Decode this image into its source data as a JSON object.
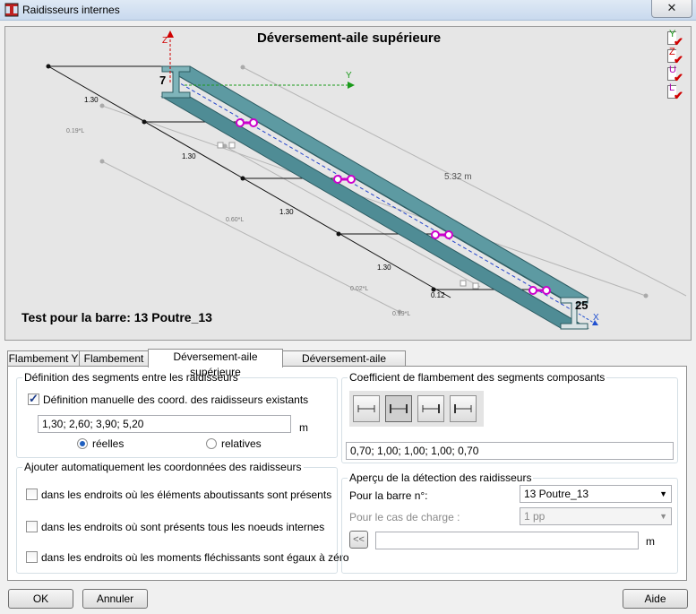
{
  "window": {
    "title": "Raidisseurs internes",
    "close_label": "✕"
  },
  "view": {
    "title": "Déversement-aile supérieure",
    "caption": "Test pour la barre: 13 Poutre_13",
    "axis_z": "Z",
    "axis_y": "Y",
    "axis_x": "X",
    "node_start": "7",
    "node_end": "25",
    "length_label": "5.32  m",
    "segment_label": "1.30",
    "offset_labels": [
      "0.19*L",
      "0.60*L",
      "0.02*L",
      "0.12",
      "0.19*L"
    ],
    "toggles": [
      {
        "label": "Y",
        "color": "#1a9a1a"
      },
      {
        "label": "Z",
        "color": "#d00000"
      },
      {
        "label": "U",
        "color": "#b000b0"
      },
      {
        "label": "L",
        "color": "#b000b0"
      }
    ],
    "colors": {
      "beam": "#5d9aa2",
      "marker": "#cc00cc",
      "axis_z": "#d00000",
      "axis_y": "#1a9a1a",
      "axis_x": "#2050d0"
    }
  },
  "tabs": [
    {
      "label": "Flambement Y",
      "active": false
    },
    {
      "label": "Flambement Z",
      "active": false
    },
    {
      "label": "Déversement-aile supérieure",
      "active": true
    },
    {
      "label": "Déversement-aile inférieure",
      "active": false
    }
  ],
  "segments": {
    "group_label": "Définition des segments entre les raidisseurs",
    "manual_label": "Définition manuelle des coord. des raidisseurs existants",
    "manual_checked": true,
    "coords_value": "1,30; 2,60; 3,90; 5,20",
    "unit": "m",
    "radio_real": "réelles",
    "radio_relative": "relatives",
    "selected": "réelles"
  },
  "auto": {
    "group_label": "Ajouter automatiquement les coordonnées des raidisseurs",
    "options": [
      {
        "label": "dans les endroits où les éléments aboutissants sont présents",
        "checked": false
      },
      {
        "label": "dans les endroits où sont présents tous les noeuds internes",
        "checked": false
      },
      {
        "label": "dans les endroits où les moments fléchissants sont égaux à zéro",
        "checked": false
      }
    ]
  },
  "coef": {
    "group_label": "Coefficient de flambement des segments composants",
    "value": "0,70; 1,00; 1,00; 1,00; 0,70"
  },
  "preview": {
    "group_label": "Aperçu de la détection des raidisseurs",
    "bar_label": "Pour la barre n°:",
    "bar_value": "13  Poutre_13",
    "case_label": "Pour le cas de charge :",
    "case_value": "1  pp",
    "nav_button": "<<",
    "unit": "m"
  },
  "buttons": {
    "ok": "OK",
    "cancel": "Annuler",
    "help": "Aide"
  }
}
